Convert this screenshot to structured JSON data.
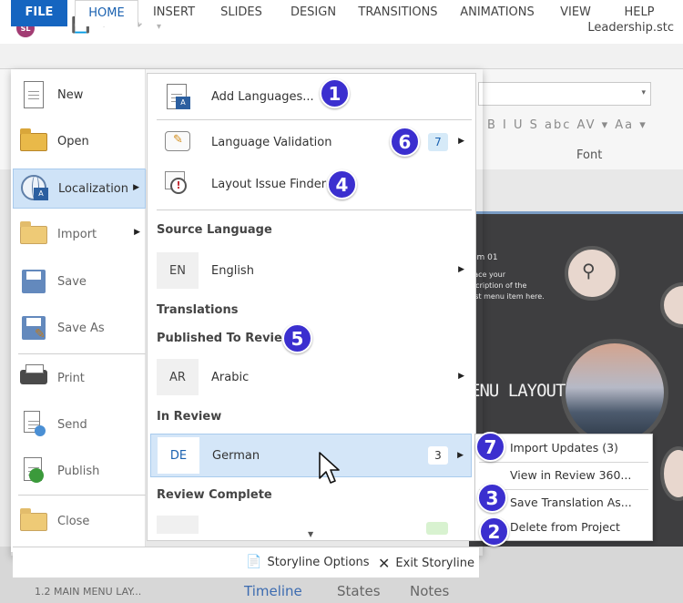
{
  "app": {
    "logo_text": "SL",
    "doc_title": "Leadership.stc"
  },
  "ribbon": {
    "tabs": [
      "FILE",
      "HOME",
      "INSERT",
      "SLIDES",
      "DESIGN",
      "TRANSITIONS",
      "ANIMATIONS",
      "VIEW",
      "HELP"
    ],
    "font_format_row": "B I U S abc AV ▾ Aa ▾",
    "font_group_label": "Font"
  },
  "backstage": {
    "nav": [
      {
        "label": "New",
        "icon": "new-document-icon"
      },
      {
        "label": "Open",
        "icon": "folder-icon"
      },
      {
        "label": "Localization",
        "icon": "globe-localization-icon"
      },
      {
        "label": "Import",
        "icon": "import-folder-icon"
      },
      {
        "label": "Save",
        "icon": "save-disk-icon"
      },
      {
        "label": "Save As",
        "icon": "save-as-icon"
      },
      {
        "label": "Print",
        "icon": "printer-icon"
      },
      {
        "label": "Send",
        "icon": "send-icon"
      },
      {
        "label": "Publish",
        "icon": "publish-icon"
      },
      {
        "label": "Close",
        "icon": "close-folder-icon"
      }
    ],
    "localization": {
      "add_languages": "Add Languages...",
      "language_validation": "Language Validation",
      "language_validation_count": "7",
      "layout_issue_finder": "Layout Issue Finder",
      "source_language_heading": "Source Language",
      "source_language": {
        "code": "EN",
        "name": "English"
      },
      "translations_heading": "Translations",
      "published_heading": "Published To Review",
      "published": [
        {
          "code": "AR",
          "name": "Arabic"
        }
      ],
      "in_review_heading": "In Review",
      "in_review": [
        {
          "code": "DE",
          "name": "German",
          "count": "3"
        }
      ],
      "review_complete_heading": "Review Complete"
    },
    "submenu": {
      "import_updates": "Import Updates (3)",
      "view_in_review": "View in Review 360...",
      "save_translation": "Save Translation As...",
      "delete_from_project": "Delete from Project"
    },
    "footer": {
      "storyline_options": "Storyline Options",
      "exit_storyline": "Exit Storyline"
    }
  },
  "callouts": [
    "1",
    "2",
    "3",
    "4",
    "5",
    "6",
    "7"
  ],
  "slide": {
    "item_title": "em 01",
    "item_desc_1": "lace your",
    "item_desc_2": "scription of the",
    "item_desc_3": "rst menu item here.",
    "heading": "ENU LAYOUT"
  },
  "bottom": {
    "scene_label": "1.2 MAIN MENU LAY...",
    "tabs": [
      "Timeline",
      "States",
      "Notes"
    ]
  },
  "colors": {
    "accent": "#1565c0",
    "callout": "#3b2fcf",
    "selection": "#d4e6f8"
  }
}
